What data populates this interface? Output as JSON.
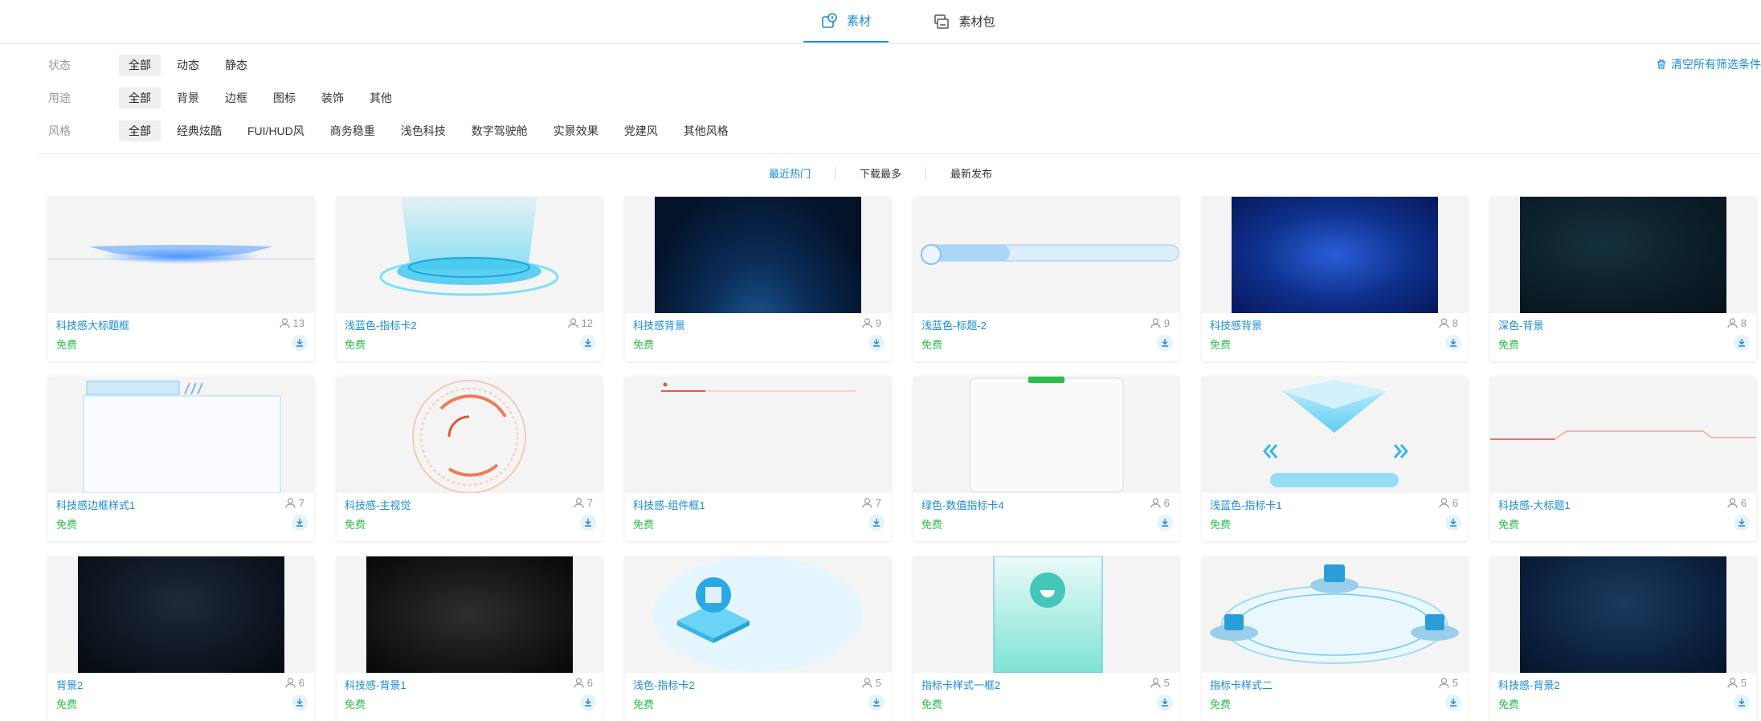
{
  "tabs": [
    {
      "label": "素材",
      "icon": "material-icon",
      "active": true
    },
    {
      "label": "素材包",
      "icon": "package-icon",
      "active": false
    }
  ],
  "filters": {
    "status": {
      "label": "状态",
      "options": [
        "全部",
        "动态",
        "静态"
      ]
    },
    "purpose": {
      "label": "用途",
      "options": [
        "全部",
        "背景",
        "边框",
        "图标",
        "装饰",
        "其他"
      ]
    },
    "style": {
      "label": "风格",
      "options": [
        "全部",
        "经典炫酷",
        "FUI/HUD风",
        "商务稳重",
        "浅色科技",
        "数字驾驶舱",
        "实景效果",
        "党建风",
        "其他风格"
      ]
    },
    "clear_all": "清空所有筛选条件"
  },
  "sort": {
    "options": [
      "最近热门",
      "下载最多",
      "最新发布"
    ],
    "active": 0
  },
  "price_label": "免费",
  "cards": [
    {
      "title": "科技感大标题框",
      "views": "13"
    },
    {
      "title": "浅蓝色-指标卡2",
      "views": "12"
    },
    {
      "title": "科技感背景",
      "views": "9"
    },
    {
      "title": "浅蓝色-标题-2",
      "views": "9"
    },
    {
      "title": "科技感背景",
      "views": "8"
    },
    {
      "title": "深色-背景",
      "views": "8"
    },
    {
      "title": "科技感边框样式1",
      "views": "7"
    },
    {
      "title": "科技感-主视觉",
      "views": "7"
    },
    {
      "title": "科技感-组件框1",
      "views": "7"
    },
    {
      "title": "绿色-数值指标卡4",
      "views": "6"
    },
    {
      "title": "浅蓝色-指标卡1",
      "views": "6"
    },
    {
      "title": "科技感-大标题1",
      "views": "6"
    },
    {
      "title": "背景2",
      "views": "6"
    },
    {
      "title": "科技感-背景1",
      "views": "6"
    },
    {
      "title": "浅色-指标卡2",
      "views": "5"
    },
    {
      "title": "指标卡样式一框2",
      "views": "5"
    },
    {
      "title": "指标卡样式二",
      "views": "5"
    },
    {
      "title": "科技感-背景2",
      "views": "5"
    }
  ],
  "colors": {
    "accent": "#1a8bd8",
    "free": "#2bbf4b"
  }
}
